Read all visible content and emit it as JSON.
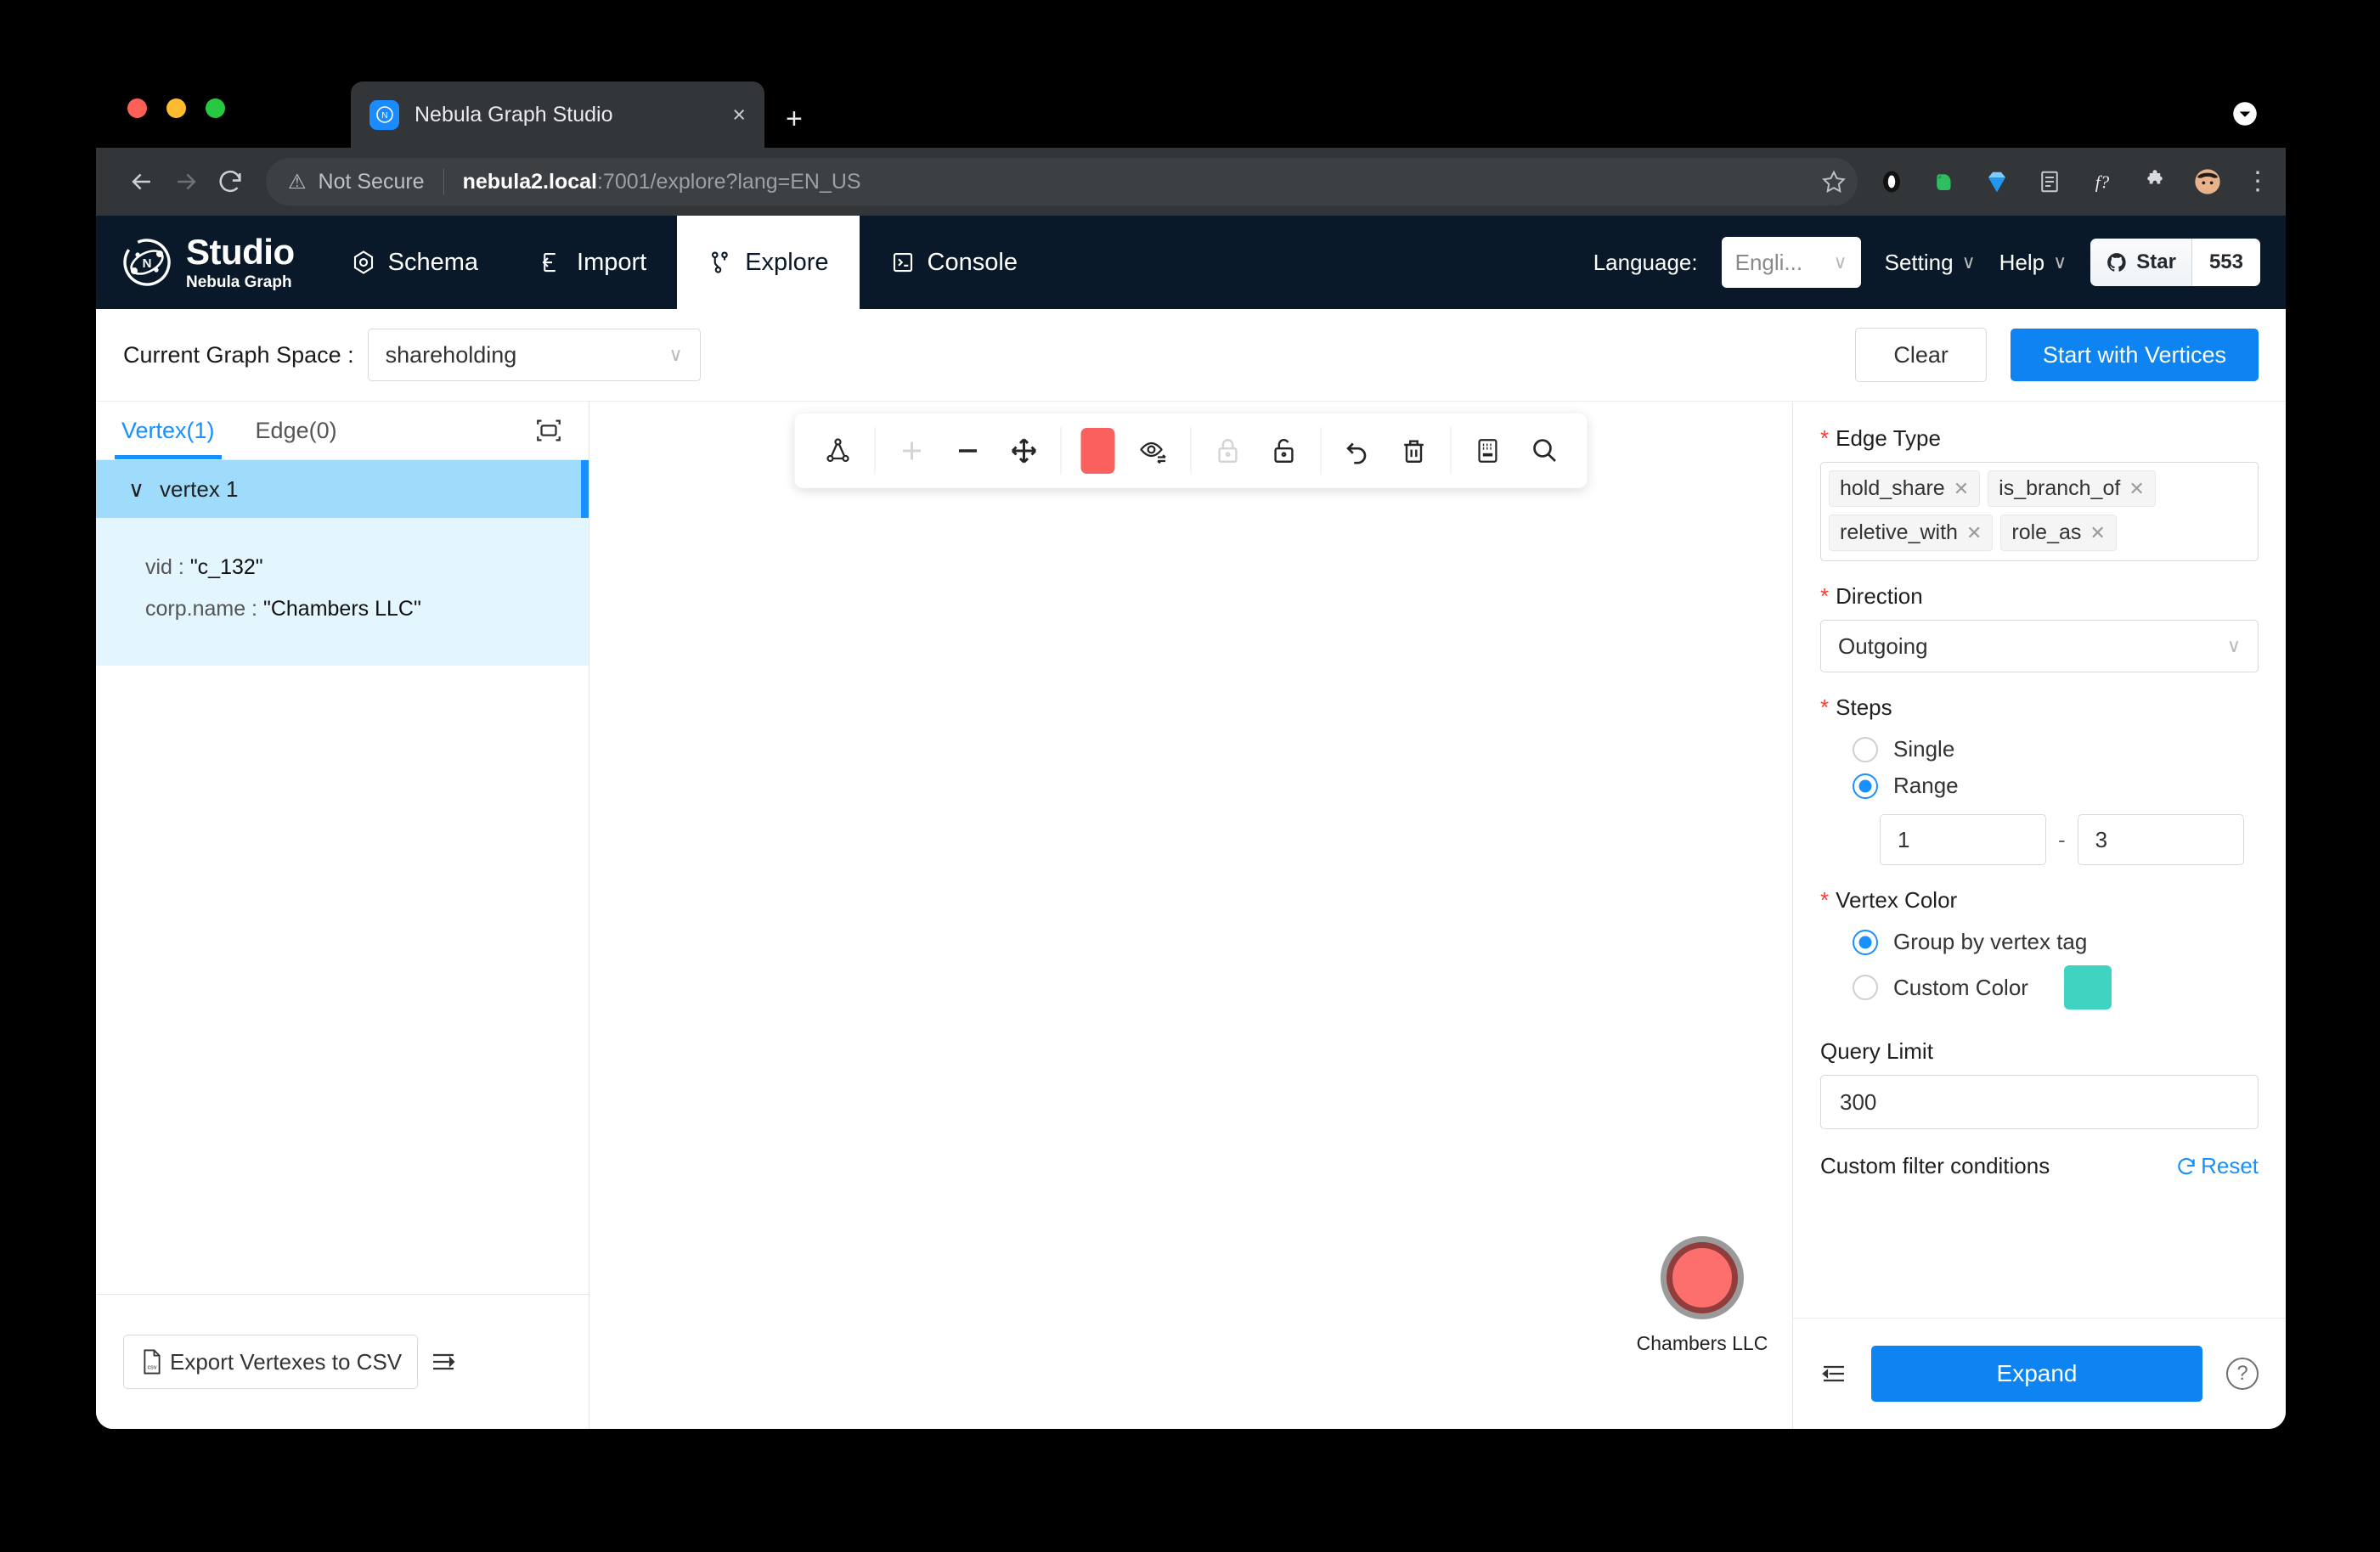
{
  "browser": {
    "tab": {
      "title": "Nebula Graph Studio",
      "favicon": "nebula-logo-icon",
      "close": "×"
    },
    "new_tab_label": "+",
    "security_label": "Not Secure",
    "url_host": "nebula2.local",
    "url_rest": ":7001/explore?lang=EN_US",
    "extensions": [
      "opera-icon",
      "evernote-icon",
      "gem-icon",
      "reader-icon",
      "f-question-icon",
      "puzzle-icon",
      "avatar-icon"
    ]
  },
  "app": {
    "logo": {
      "title": "Studio",
      "subtitle": "Nebula Graph"
    },
    "nav": [
      {
        "label": "Schema",
        "icon": "schema-icon",
        "active": false
      },
      {
        "label": "Import",
        "icon": "import-icon",
        "active": false
      },
      {
        "label": "Explore",
        "icon": "explore-icon",
        "active": true
      },
      {
        "label": "Console",
        "icon": "console-icon",
        "active": false
      }
    ],
    "language_label": "Language:",
    "language_value": "Engli...",
    "setting_label": "Setting",
    "help_label": "Help",
    "github": {
      "star_label": "Star",
      "count": "553"
    }
  },
  "spacebar": {
    "label": "Current Graph Space :",
    "space_value": "shareholding",
    "clear_label": "Clear",
    "start_label": "Start with Vertices"
  },
  "left_panel": {
    "tabs": [
      {
        "label": "Vertex(1)",
        "active": true
      },
      {
        "label": "Edge(0)",
        "active": false
      }
    ],
    "fit_icon": "fit-to-screen-icon",
    "vertex_group_label": "vertex 1",
    "properties": [
      {
        "key": "vid :",
        "value": "\"c_132\""
      },
      {
        "key": "corp.name :",
        "value": "\"Chambers LLC\""
      }
    ],
    "export_label": "Export Vertexes to CSV",
    "collapse_icon": "collapse-panel-icon"
  },
  "canvas": {
    "toolbar": [
      {
        "name": "graph-layout-icon"
      },
      {
        "name": "zoom-in-icon"
      },
      {
        "name": "zoom-out-icon"
      },
      {
        "name": "fit-move-icon"
      },
      {
        "name": "color-swatch",
        "color": "#f9605e"
      },
      {
        "name": "show-hide-icon"
      },
      {
        "name": "lock-icon"
      },
      {
        "name": "unlock-icon"
      },
      {
        "name": "undo-icon"
      },
      {
        "name": "delete-icon"
      },
      {
        "name": "keyboard-icon"
      },
      {
        "name": "search-icon"
      }
    ],
    "nodes": [
      {
        "label": "Chambers LLC",
        "fill": "#fc6f6d",
        "ring": "#913d3c",
        "halo": "#9a9a9a"
      }
    ]
  },
  "right_panel": {
    "edge_type_label": "Edge Type",
    "edge_types": [
      "hold_share",
      "is_branch_of",
      "reletive_with",
      "role_as"
    ],
    "direction_label": "Direction",
    "direction_value": "Outgoing",
    "steps_label": "Steps",
    "steps_options": [
      {
        "label": "Single",
        "selected": false
      },
      {
        "label": "Range",
        "selected": true
      }
    ],
    "range_min": "1",
    "range_sep": "-",
    "range_max": "3",
    "vertex_color_label": "Vertex Color",
    "vertex_color_options": [
      {
        "label": "Group by vertex tag",
        "selected": true
      },
      {
        "label": "Custom Color",
        "selected": false
      }
    ],
    "custom_color": "#3fd3c1",
    "query_limit_label": "Query Limit",
    "query_limit_value": "300",
    "filter_label": "Custom filter conditions",
    "reset_label": "Reset",
    "indent_icon": "indent-icon",
    "expand_label": "Expand",
    "help_icon": "?"
  }
}
